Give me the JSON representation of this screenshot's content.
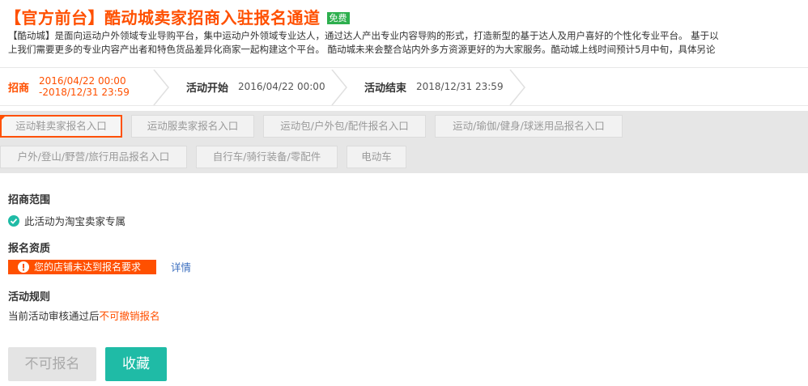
{
  "header": {
    "title": "【官方前台】酷动城卖家招商入驻报名通道",
    "badge": "免费"
  },
  "description": {
    "line1": "【酷动城】是面向运动户外领域专业导购平台，集中运动户外领域专业达人，通过达人产出专业内容导购的形式，打造新型的基于达人及用户喜好的个性化专业平台。 基于以",
    "line2": "上我们需要更多的专业内容产出者和特色货品差异化商家一起构建这个平台。 酷动城未来会整合站内外多方资源更好的为大家服务。酷动城上线时间预计5月中旬，具体另论"
  },
  "timeline": {
    "steps": [
      {
        "label": "招商",
        "time_line1": "2016/04/22 00:00",
        "time_line2": "-2018/12/31 23:59"
      },
      {
        "label": "活动开始",
        "time": "2016/04/22 00:00"
      },
      {
        "label": "活动结束",
        "time": "2018/12/31 23:59"
      }
    ]
  },
  "tabs": [
    {
      "label": "运动鞋卖家报名入口",
      "active": true
    },
    {
      "label": "运动服卖家报名入口"
    },
    {
      "label": "运动包/户外包/配件报名入口"
    },
    {
      "label": "运动/瑜伽/健身/球迷用品报名入口"
    },
    {
      "label": "户外/登山/野营/旅行用品报名入口"
    },
    {
      "label": "自行车/骑行装备/零配件"
    },
    {
      "label": "电动车"
    }
  ],
  "scope": {
    "title": "招商范围",
    "text": "此活动为淘宝卖家专属"
  },
  "qualification": {
    "title": "报名资质",
    "warning": "您的店铺未达到报名要求",
    "detail_link": "详情"
  },
  "rules": {
    "title": "活动规则",
    "text_prefix": "当前活动审核通过后",
    "text_highlight": "不可撤销报名"
  },
  "buttons": {
    "apply": "不可报名",
    "collect": "收藏"
  },
  "colors": {
    "accent": "#ff5000",
    "badge": "#2daf4e",
    "teal": "#1fbba6",
    "link": "#3a6ebf"
  }
}
